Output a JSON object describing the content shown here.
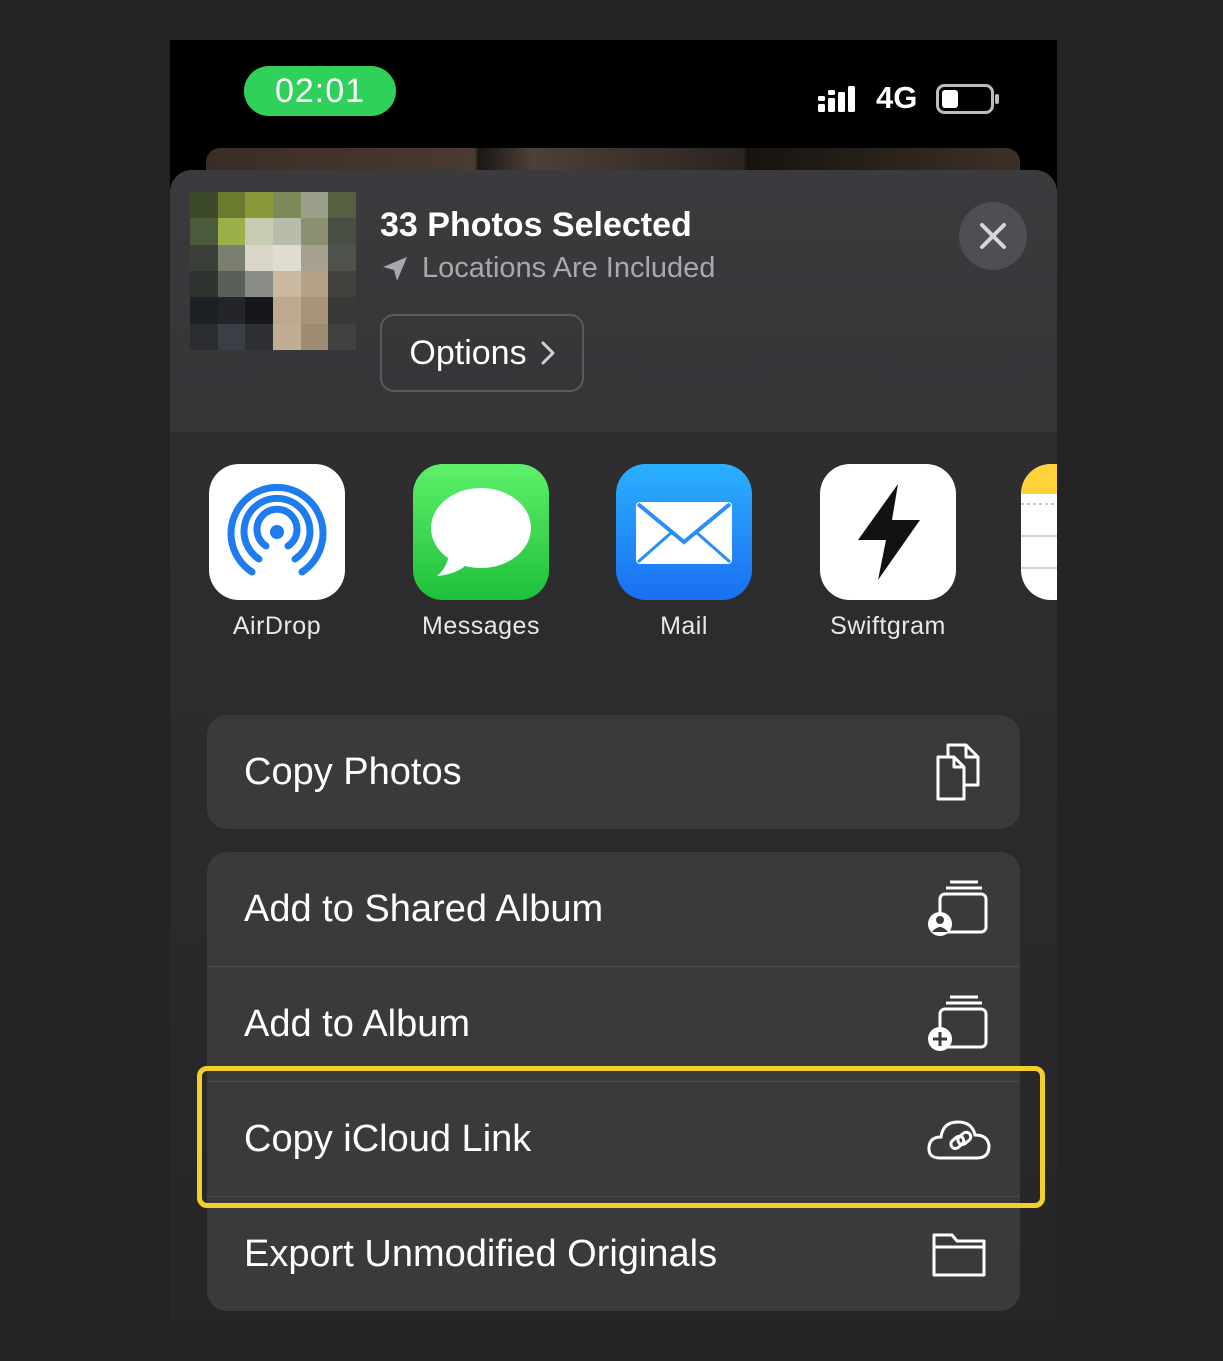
{
  "status_bar": {
    "time": "02:01",
    "network": "4G"
  },
  "share_sheet": {
    "title": "33 Photos Selected",
    "subtitle": "Locations Are Included",
    "options_label": "Options"
  },
  "apps": [
    {
      "label": "AirDrop",
      "icon": "airdrop-icon"
    },
    {
      "label": "Messages",
      "icon": "messages-icon"
    },
    {
      "label": "Mail",
      "icon": "mail-icon"
    },
    {
      "label": "Swiftgram",
      "icon": "swiftgram-icon"
    },
    {
      "label": "",
      "icon": "notes-icon"
    }
  ],
  "actions": [
    {
      "label": "Copy Photos",
      "icon": "copy-icon"
    },
    {
      "label": "Add to Shared Album",
      "icon": "shared-album-icon"
    },
    {
      "label": "Add to Album",
      "icon": "add-album-icon"
    },
    {
      "label": "Copy iCloud Link",
      "icon": "icloud-link-icon",
      "highlighted": true
    },
    {
      "label": "Export Unmodified Originals",
      "icon": "folder-icon"
    }
  ],
  "colors": {
    "time_pill": "#2fd15a",
    "highlight": "#f3cf2a",
    "row_background": "#3a3a3c"
  }
}
